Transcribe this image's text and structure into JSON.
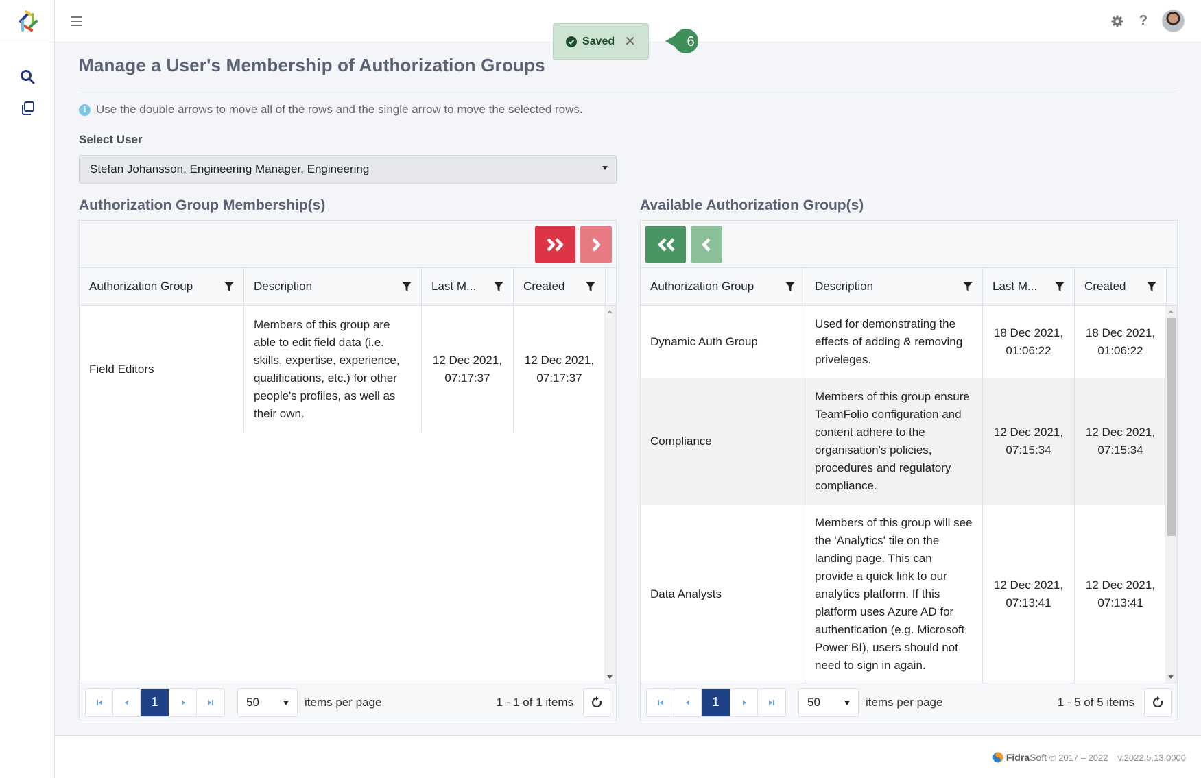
{
  "app": {
    "brand_colors": {
      "primary": "#1f4287",
      "danger": "#dc3545",
      "danger_light": "#e77a83",
      "success": "#4a9563",
      "success_light": "#8abf98"
    }
  },
  "topbar": {
    "menu_icon": "hamburger-icon",
    "settings_icon": "gear-icon",
    "help_icon": "question-icon",
    "help_label": "?",
    "avatar_icon": "user-avatar"
  },
  "sidebar": {
    "items": [
      {
        "icon": "search-icon",
        "label": "Search"
      },
      {
        "icon": "copy-icon",
        "label": "Copy"
      }
    ]
  },
  "toast": {
    "icon": "check-circle-icon",
    "text": "Saved",
    "close": "✕"
  },
  "callout": {
    "number": "6"
  },
  "page": {
    "title": "Manage a User's Membership of Authorization Groups",
    "info": "Use the double arrows to move all of the rows and the single arrow to move the selected rows.",
    "select_label": "Select User",
    "selected_user": "Stefan Johansson, Engineering Manager, Engineering"
  },
  "left_panel": {
    "title": "Authorization Group Membership(s)",
    "buttons": [
      {
        "name": "move-all-right",
        "icon": "double-chevron-right-icon"
      },
      {
        "name": "move-selected-right",
        "icon": "chevron-right-icon"
      }
    ],
    "columns": [
      "Authorization Group",
      "Description",
      "Last M...",
      "Created"
    ],
    "rows": [
      {
        "group": "Field Editors",
        "description": "Members of this group are able to edit field data (i.e. skills, expertise, experience, qualifications, etc.) for other people's profiles, as well as their own.",
        "last_modified": "12 Dec 2021, 07:17:37",
        "created": "12 Dec 2021, 07:17:37"
      }
    ],
    "pager": {
      "current_page": "1",
      "page_size": "50",
      "items_per_page_label": "items per page",
      "info": "1 - 1 of 1 items"
    }
  },
  "right_panel": {
    "title": "Available Authorization Group(s)",
    "buttons": [
      {
        "name": "move-all-left",
        "icon": "double-chevron-left-icon"
      },
      {
        "name": "move-selected-left",
        "icon": "chevron-left-icon"
      }
    ],
    "columns": [
      "Authorization Group",
      "Description",
      "Last M...",
      "Created"
    ],
    "rows": [
      {
        "group": "Dynamic Auth Group",
        "description": "Used for demonstrating the effects of adding & removing priveleges.",
        "last_modified": "18 Dec 2021, 01:06:22",
        "created": "18 Dec 2021, 01:06:22"
      },
      {
        "group": "Compliance",
        "description": "Members of this group ensure TeamFolio configuration and content adhere to the organisation's policies, procedures and regulatory compliance.",
        "last_modified": "12 Dec 2021, 07:15:34",
        "created": "12 Dec 2021, 07:15:34"
      },
      {
        "group": "Data Analysts",
        "description": "Members of this group will see the 'Analytics' tile on the landing page. This can provide a quick link to our analytics platform. If this platform uses Azure AD for authentication (e.g. Microsoft Power BI), users should not need to sign in again.",
        "last_modified": "12 Dec 2021, 07:13:41",
        "created": "12 Dec 2021, 07:13:41"
      }
    ],
    "pager": {
      "current_page": "1",
      "page_size": "50",
      "items_per_page_label": "items per page",
      "info": "1 - 5 of 5 items"
    }
  },
  "footer": {
    "brand_bold": "Fidra",
    "brand_light": "Soft",
    "copyright": "© 2017 – 2022",
    "version": "v.2022.5.13.0000"
  }
}
